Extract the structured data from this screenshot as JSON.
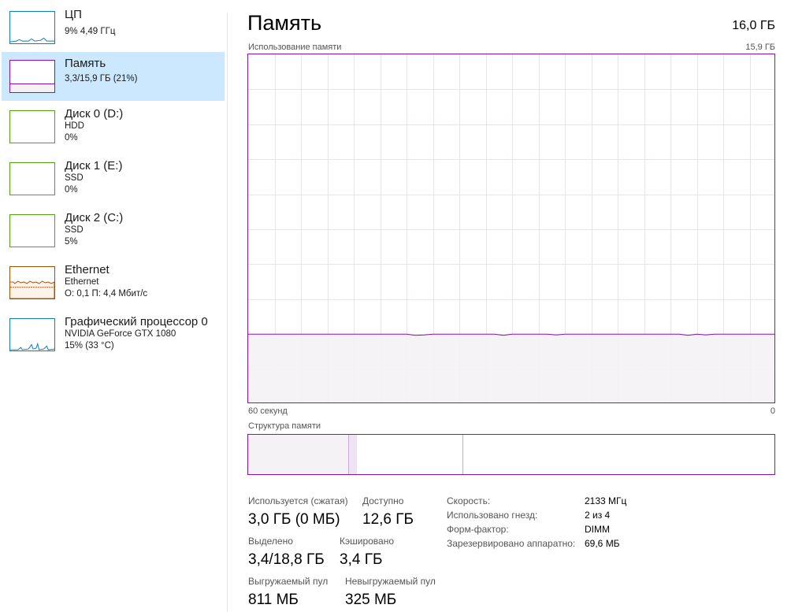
{
  "sidebar": {
    "items": [
      {
        "title": "ЦП",
        "line1": "9% 4,49 ГГц",
        "line2": "",
        "color": "#117dbb",
        "fill": "#f1f6fa"
      },
      {
        "title": "Память",
        "line1": "3,3/15,9 ГБ (21%)",
        "line2": "",
        "color": "#8b12ae",
        "fill": "#f4f2f4"
      },
      {
        "title": "Диск 0 (D:)",
        "line1": "HDD",
        "line2": "0%",
        "color": "#4da60c",
        "fill": "#eff7ea"
      },
      {
        "title": "Диск 1 (E:)",
        "line1": "SSD",
        "line2": "0%",
        "color": "#4da60c",
        "fill": "#eff7ea"
      },
      {
        "title": "Диск 2 (C:)",
        "line1": "SSD",
        "line2": "5%",
        "color": "#4da60c",
        "fill": "#eff7ea"
      },
      {
        "title": "Ethernet",
        "line1": "Ethernet",
        "line2": "О: 0,1 П: 4,4 Мбит/с",
        "color": "#a74f01",
        "fill": "#fcf3eb"
      },
      {
        "title": "Графический процессор 0",
        "line1": "NVIDIA GeForce GTX 1080",
        "line2": "15% (33 °C)",
        "color": "#117dbb",
        "fill": "#f1f6fa"
      }
    ]
  },
  "main": {
    "title": "Память",
    "total": "16,0 ГБ",
    "usage_label": "Использование памяти",
    "usage_max": "15,9 ГБ",
    "time_left": "60 секунд",
    "time_right": "0",
    "structure_label": "Структура памяти",
    "usage_fraction": 0.2,
    "structure": {
      "in_use_fraction": 0.19,
      "modified_fraction": 0.016,
      "standby_fraction": 0.2
    }
  },
  "stats": {
    "in_use_label": "Используется (сжатая)",
    "in_use_value": "3,0 ГБ (0 МБ)",
    "available_label": "Доступно",
    "available_value": "12,6 ГБ",
    "committed_label": "Выделено",
    "committed_value": "3,4/18,8 ГБ",
    "cached_label": "Кэшировано",
    "cached_value": "3,4 ГБ",
    "paged_label": "Выгружаемый пул",
    "paged_value": "811 МБ",
    "nonpaged_label": "Невыгружаемый пул",
    "nonpaged_value": "325 МБ"
  },
  "details": [
    {
      "label": "Скорость:",
      "value": "2133 МГц"
    },
    {
      "label": "Использовано гнезд:",
      "value": "2 из 4"
    },
    {
      "label": "Форм-фактор:",
      "value": "DIMM"
    },
    {
      "label": "Зарезервировано аппаратно:",
      "value": "69,6 МБ"
    }
  ],
  "colors": {
    "memory_accent": "#8b12ae",
    "grid": "#e9e4ec",
    "memory_fill": "#f4f2f4",
    "selected_bg": "#cce8ff"
  }
}
